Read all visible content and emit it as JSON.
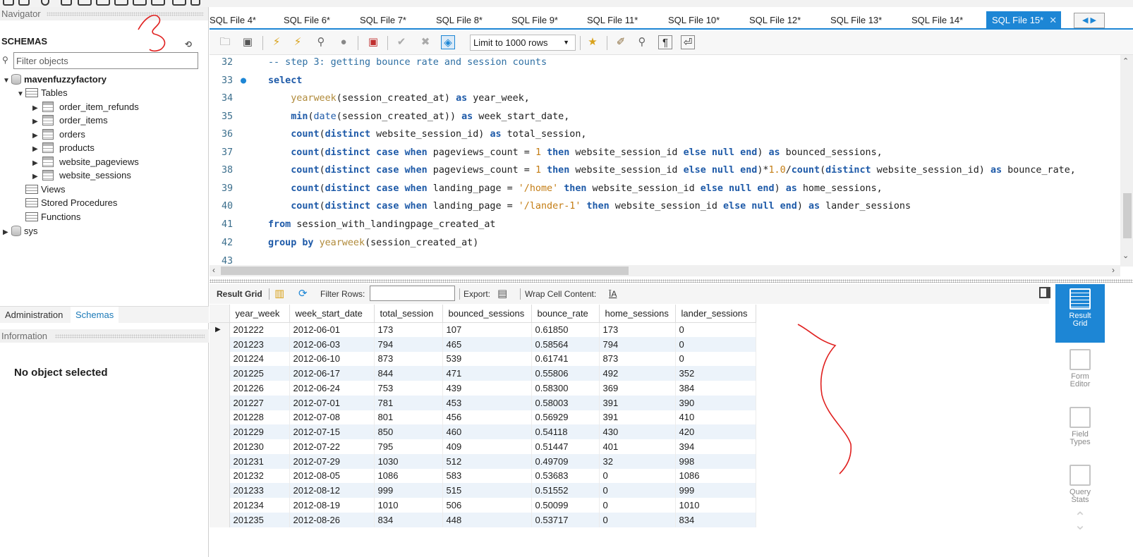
{
  "navigator": {
    "header": "Navigator",
    "schemas_label": "SCHEMAS",
    "filter_placeholder": "Filter objects",
    "tree": {
      "db": "mavenfuzzyfactory",
      "tables_label": "Tables",
      "tables": [
        "order_item_refunds",
        "order_items",
        "orders",
        "products",
        "website_pageviews",
        "website_sessions"
      ],
      "views_label": "Views",
      "procedures_label": "Stored Procedures",
      "functions_label": "Functions",
      "sys": "sys"
    },
    "bottom_tabs": [
      "Administration",
      "Schemas"
    ],
    "information_header": "Information",
    "no_object": "No object selected"
  },
  "tabs": [
    "SQL File 4*",
    "SQL File 6*",
    "SQL File 7*",
    "SQL File 8*",
    "SQL File 9*",
    "SQL File 11*",
    "SQL File 10*",
    "SQL File 12*",
    "SQL File 13*",
    "SQL File 14*",
    "SQL File 15*"
  ],
  "toolbar": {
    "limit": "Limit to 1000 rows"
  },
  "editor": {
    "line_numbers": [
      "32",
      "33",
      "34",
      "35",
      "36",
      "37",
      "38",
      "39",
      "40",
      "41",
      "42",
      "43"
    ]
  },
  "result_toolbar": {
    "result_grid": "Result Grid",
    "filter_rows": "Filter Rows:",
    "export": "Export:",
    "wrap": "Wrap Cell Content:"
  },
  "grid": {
    "columns": [
      "year_week",
      "week_start_date",
      "total_session",
      "bounced_sessions",
      "bounce_rate",
      "home_sessions",
      "lander_sessions"
    ],
    "rows": [
      [
        "201222",
        "2012-06-01",
        "173",
        "107",
        "0.61850",
        "173",
        "0"
      ],
      [
        "201223",
        "2012-06-03",
        "794",
        "465",
        "0.58564",
        "794",
        "0"
      ],
      [
        "201224",
        "2012-06-10",
        "873",
        "539",
        "0.61741",
        "873",
        "0"
      ],
      [
        "201225",
        "2012-06-17",
        "844",
        "471",
        "0.55806",
        "492",
        "352"
      ],
      [
        "201226",
        "2012-06-24",
        "753",
        "439",
        "0.58300",
        "369",
        "384"
      ],
      [
        "201227",
        "2012-07-01",
        "781",
        "453",
        "0.58003",
        "391",
        "390"
      ],
      [
        "201228",
        "2012-07-08",
        "801",
        "456",
        "0.56929",
        "391",
        "410"
      ],
      [
        "201229",
        "2012-07-15",
        "850",
        "460",
        "0.54118",
        "430",
        "420"
      ],
      [
        "201230",
        "2012-07-22",
        "795",
        "409",
        "0.51447",
        "401",
        "394"
      ],
      [
        "201231",
        "2012-07-29",
        "1030",
        "512",
        "0.49709",
        "32",
        "998"
      ],
      [
        "201232",
        "2012-08-05",
        "1086",
        "583",
        "0.53683",
        "0",
        "1086"
      ],
      [
        "201233",
        "2012-08-12",
        "999",
        "515",
        "0.51552",
        "0",
        "999"
      ],
      [
        "201234",
        "2012-08-19",
        "1010",
        "506",
        "0.50099",
        "0",
        "1010"
      ],
      [
        "201235",
        "2012-08-26",
        "834",
        "448",
        "0.53717",
        "0",
        "834"
      ]
    ]
  },
  "side_panel": {
    "result_grid": [
      "Result",
      "Grid"
    ],
    "form_editor": [
      "Form",
      "Editor"
    ],
    "field_types": [
      "Field",
      "Types"
    ],
    "query_stats": [
      "Query",
      "Stats"
    ]
  },
  "colors": {
    "accent": "#1d86d5",
    "keyword": "#1e5aa8",
    "string": "#c47d14",
    "annotation": "#e0201f"
  }
}
